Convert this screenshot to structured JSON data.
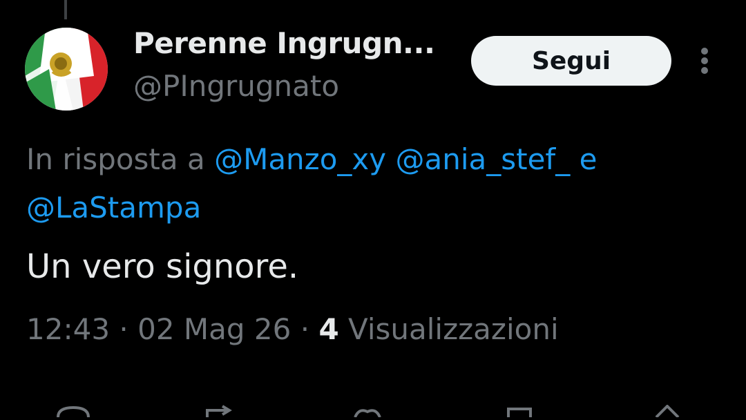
{
  "tweet": {
    "author": {
      "display_name": "Perenne Ingrugn...",
      "handle": "@PIngrugnato",
      "avatar_icon": "italy-flag-lion-avatar"
    },
    "follow_label": "Segui",
    "more_icon": "more-vertical-icon",
    "reply_context": {
      "prefix": "In risposta a",
      "mention_1": "@Manzo_xy",
      "mention_2": "@ania_stef_",
      "conjunction": "e",
      "mention_3": "@LaStampa"
    },
    "text": "Un vero signore.",
    "meta": {
      "time": "12:43",
      "separator": "·",
      "date": "02 Mag 26",
      "views_count": "4",
      "views_label": "Visualizzazioni"
    }
  },
  "colors": {
    "background": "#000000",
    "primary_text": "#e7e9ea",
    "secondary_text": "#71767b",
    "link": "#1d9bf0",
    "button_bg": "#eff3f4"
  }
}
